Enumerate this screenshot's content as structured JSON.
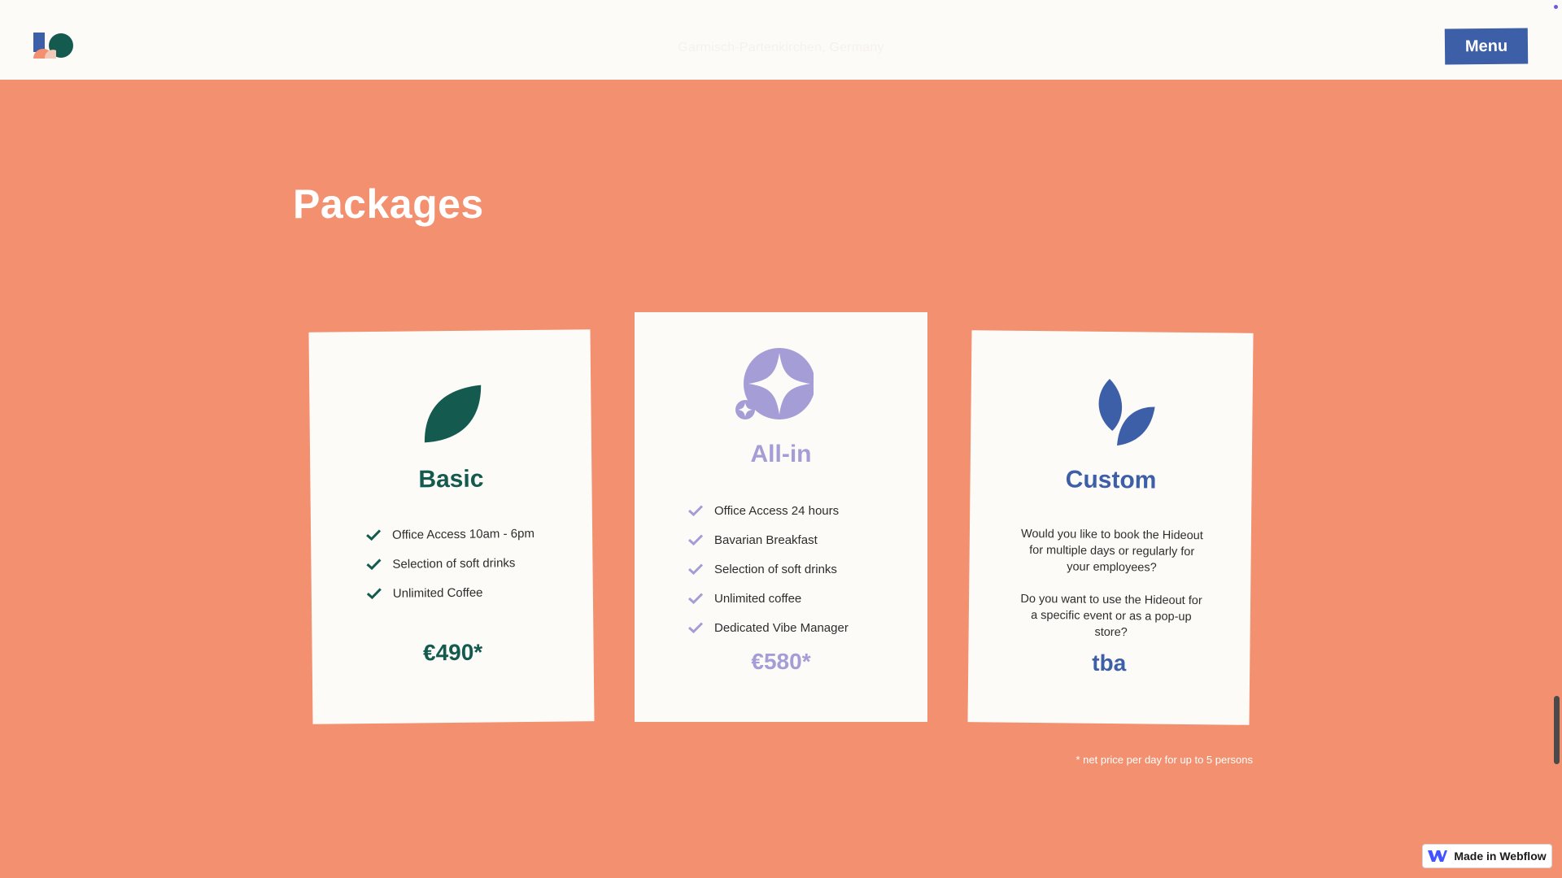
{
  "header": {
    "location": "Garmisch-Partenkirchen, Germany",
    "menu_label": "Menu"
  },
  "page": {
    "title": "Packages"
  },
  "packages": [
    {
      "name": "Basic",
      "icon": "leaf-icon",
      "color": "#145a4f",
      "features": [
        "Office Access 10am - 6pm",
        "Selection of soft drinks",
        "Unlimited Coffee"
      ],
      "price": "€490*"
    },
    {
      "name": "All-in",
      "icon": "sparkle-star-icon",
      "color": "#a49dd6",
      "features": [
        "Office Access 24 hours",
        "Bavarian Breakfast",
        "Selection of soft drinks",
        "Unlimited coffee",
        "Dedicated Vibe Manager"
      ],
      "price": "€580*"
    },
    {
      "name": "Custom",
      "icon": "double-leaf-icon",
      "color": "#3d5fa8",
      "paragraphs": [
        "Would you like to book the Hideout for multiple days or regularly for your employees?",
        "Do you want to use the Hideout for a specific event or as a pop-up store?"
      ],
      "price": "tba"
    }
  ],
  "footnote": "* net price per day for up to 5 persons",
  "badge": {
    "label": "Made in Webflow"
  },
  "colors": {
    "background": "#f2906f",
    "card": "#fdfbf8",
    "menu_button": "#3d5fa8"
  }
}
